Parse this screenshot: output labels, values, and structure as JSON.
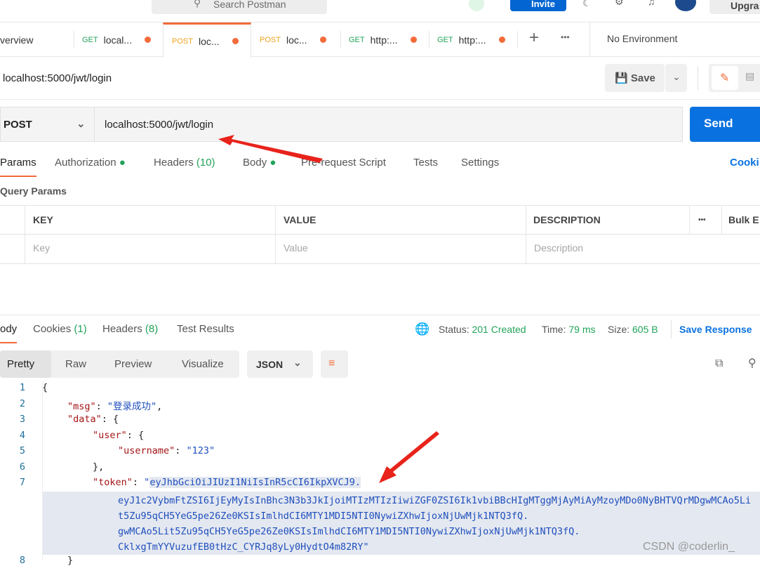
{
  "topbar": {
    "search_placeholder": "Search Postman",
    "invite": "Invite",
    "upgrade": "Upgra"
  },
  "tabs": [
    {
      "label": "verview"
    },
    {
      "method": "GET",
      "label": "local..."
    },
    {
      "method": "POST",
      "label": "loc...",
      "active": true
    },
    {
      "method": "POST",
      "label": "loc..."
    },
    {
      "method": "GET",
      "label": "http:..."
    },
    {
      "method": "GET",
      "label": "http:..."
    }
  ],
  "environment": "No Environment",
  "request": {
    "title": "localhost:5000/jwt/login",
    "save": "Save",
    "method": "POST",
    "url": "localhost:5000/jwt/login",
    "send": "Send"
  },
  "req_tabs": {
    "params": "Params",
    "authorization": "Authorization",
    "headers": "Headers",
    "headers_count": "(10)",
    "body": "Body",
    "prerequest": "Pre-request Script",
    "tests": "Tests",
    "settings": "Settings",
    "cookies": "Cooki"
  },
  "query_params": {
    "title": "Query Params",
    "headers": [
      "KEY",
      "VALUE",
      "DESCRIPTION"
    ],
    "bulk": "Bulk E",
    "placeholders": [
      "Key",
      "Value",
      "Description"
    ]
  },
  "response": {
    "tabs": {
      "body": "ody",
      "cookies": "Cookies",
      "cookies_count": "(1)",
      "headers": "Headers",
      "headers_count": "(8)",
      "test_results": "Test Results"
    },
    "status_label": "Status:",
    "status": "201 Created",
    "time_label": "Time:",
    "time": "79 ms",
    "size_label": "Size:",
    "size": "605 B",
    "save_response": "Save Response",
    "views": [
      "Pretty",
      "Raw",
      "Preview",
      "Visualize"
    ],
    "format": "JSON"
  },
  "code": {
    "line_numbers": [
      "1",
      "2",
      "3",
      "4",
      "5",
      "6",
      "7",
      "8"
    ],
    "l1": "{",
    "msg_key": "\"msg\"",
    "msg_val": "\"登录成功\"",
    "data_key": "\"data\"",
    "user_key": "\"user\"",
    "username_key": "\"username\"",
    "username_val": "\"123\"",
    "close_user": "},",
    "token_key": "\"token\"",
    "token_parts": [
      "eyJhbGciOiJIUzI1NiIsInR5cCI6IkpXVCJ9.",
      "eyJ1c2VybmFtZSI6IjEyMyIsInBhc3N3b3JkIjoiMTIzMTIzIiwiZGF0ZSI6Ik1vbiBBcHIgMTggMjAyMiAyMzoyMDo0NyBHTVQrMDgwMCAo5Lit5Zu95qCH5YeG5pe26Ze0KSIsImlhdCI6MTY1MDI5NTI0NywiZXhwIjoxNjUwMjk1NTQ3fQ.",
      "gwMCAo5Lit5Zu95qCH5YeG5pe26Ze0KSIsImlhdCI6MTY1MDI5NTI0NywiZXhwIjoxNjUwMjk1NTQ3fQ.",
      "CklxgTmYYVuzufEB0tHzC_CYRJq8yLy0HydtO4m82RY"
    ],
    "l8": "}"
  },
  "watermark": "CSDN @coderlin_",
  "colors": {
    "accent": "#0a72e0",
    "orange": "#f26b3a",
    "get": "#22a35a",
    "post": "#f0a21b",
    "status_ok": "#22a35a",
    "arrow": "#e8231b"
  }
}
